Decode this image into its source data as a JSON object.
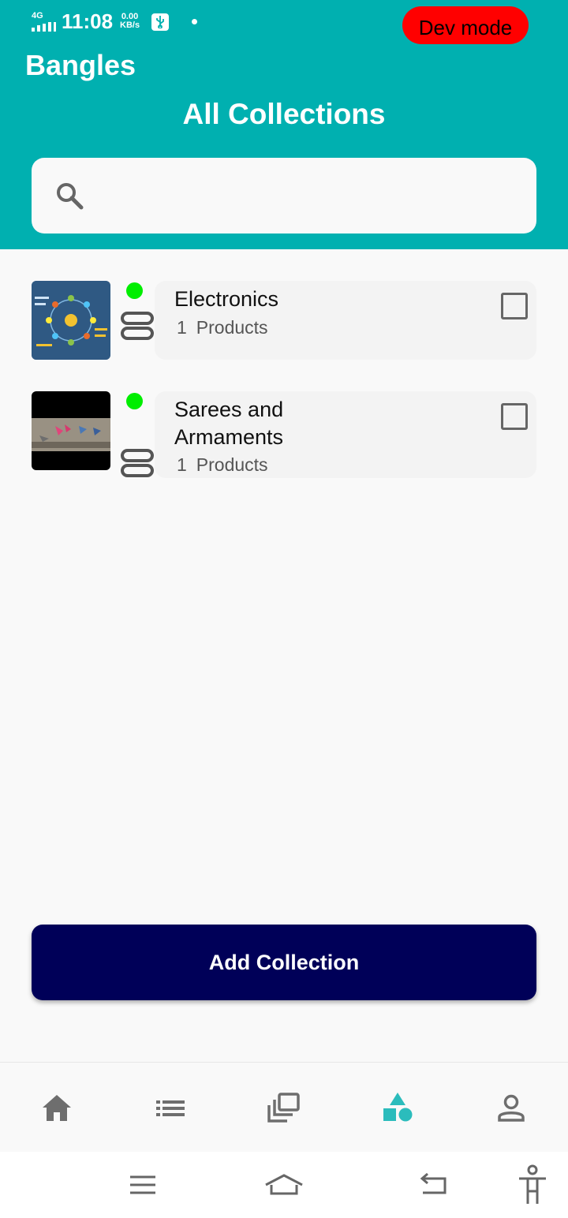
{
  "status_bar": {
    "network": "4G",
    "time": "11:08",
    "speed_value": "0.00",
    "speed_unit": "KB/s",
    "dev_mode_label": "Dev mode"
  },
  "header": {
    "store_name": "Bangles",
    "page_title": "All Collections"
  },
  "search": {
    "value": "",
    "placeholder": ""
  },
  "collections": [
    {
      "title": "Electronics",
      "count": "1",
      "count_label": "Products",
      "active": true,
      "checked": false
    },
    {
      "title": "Sarees and Armaments",
      "count": "1",
      "count_label": "Products",
      "active": true,
      "checked": false
    }
  ],
  "add_button_label": "Add Collection",
  "bottom_nav": {
    "items": [
      "home-icon",
      "list-icon",
      "gallery-icon",
      "collections-icon",
      "person-icon"
    ],
    "active": "collections-icon"
  },
  "colors": {
    "header": "#00b0b0",
    "accent": "#2bbcbc",
    "button": "#000058",
    "active_dot": "#00ee00",
    "dev_mode": "#ff0000"
  }
}
